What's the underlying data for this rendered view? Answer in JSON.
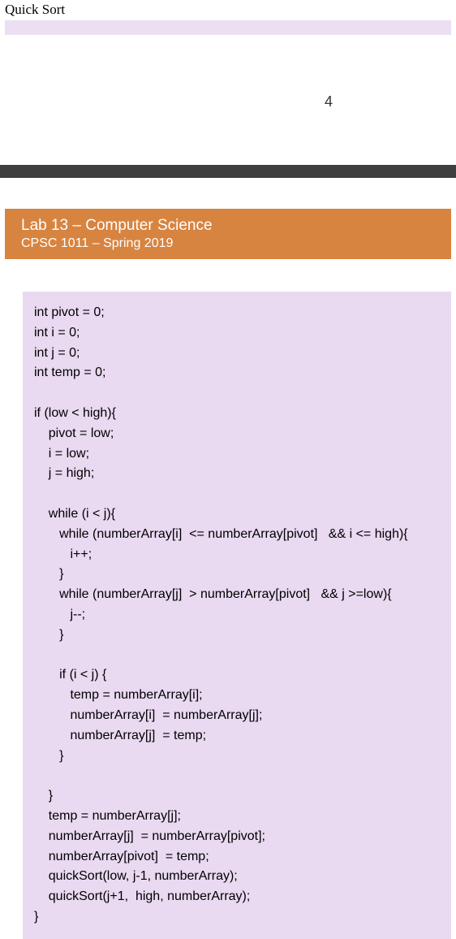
{
  "top": {
    "title": "Quick Sort"
  },
  "page_number": "4",
  "header": {
    "title": "Lab 13 – Computer Science",
    "subtitle": "CPSC 1011 – Spring 2019"
  },
  "code": "int pivot = 0;\nint i = 0;\nint j = 0;\nint temp = 0;\n\nif (low < high){\n    pivot = low;\n    i = low;\n    j = high;\n\n    while (i < j){\n       while (numberArray[i]  <= numberArray[pivot]   && i <= high){\n          i++;\n       }\n       while (numberArray[j]  > numberArray[pivot]   && j >=low){\n          j--;\n       }\n\n       if (i < j) {\n          temp = numberArray[i];\n          numberArray[i]  = numberArray[j];\n          numberArray[j]  = temp;\n       }\n\n    }\n    temp = numberArray[j];\n    numberArray[j]  = numberArray[pivot];\n    numberArray[pivot]  = temp;\n    quickSort(low, j-1, numberArray);\n    quickSort(j+1,  high, numberArray);\n}"
}
